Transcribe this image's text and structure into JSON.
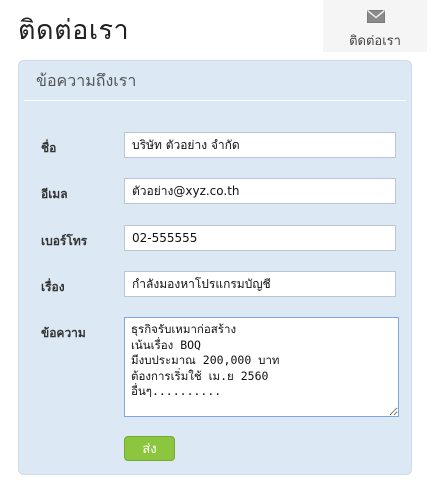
{
  "page": {
    "title": "ติดต่อเรา"
  },
  "tab": {
    "label": "ติดต่อเรา",
    "icon": "mail-icon"
  },
  "panel": {
    "header": "ข้อความถึงเรา"
  },
  "form": {
    "name_label": "ชื่อ",
    "name_value": "บริษัท ตัวอย่าง จำกัด",
    "email_label": "อีเมล",
    "email_value": "ตัวอย่าง@xyz.co.th",
    "phone_label": "เบอร์โทร",
    "phone_value": "02-555555",
    "subject_label": "เรื่อง",
    "subject_value": "กำลังมองหาโปรแกรมบัญชี",
    "message_label": "ข้อความ",
    "message_value": "ธุรกิจรับเหมาก่อสร้าง\nเน้นเรื่อง BOQ\nมีงบประมาณ 200,000 บาท\nต้องการเริ่มใช้ เม.ย 2560\nอื่นๆ..........",
    "submit_label": "ส่ง"
  },
  "colors": {
    "panel": "#dce8f4",
    "submit": "#8cc63f",
    "focus_border": "#7fa7d7"
  }
}
